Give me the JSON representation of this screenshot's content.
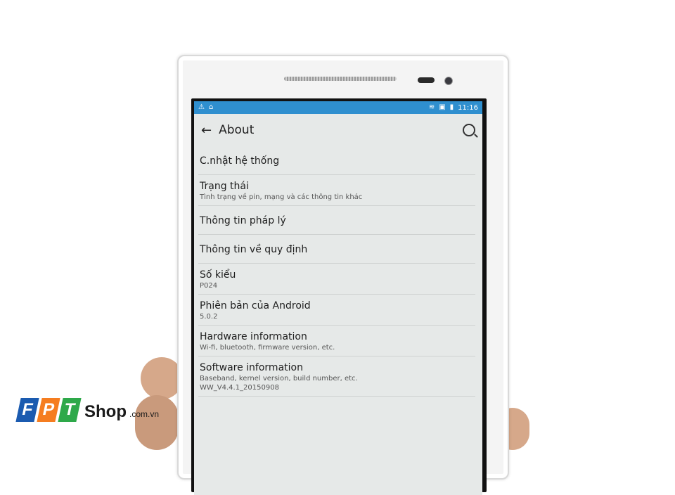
{
  "statusbar": {
    "time": "11:16",
    "left_icons": [
      "warning-icon",
      "home-icon"
    ],
    "right_icons": [
      "wifi-icon",
      "sim-icon",
      "battery-icon"
    ],
    "color": "#2f8fcf"
  },
  "appbar": {
    "title": "About",
    "back_icon": "arrow-left-icon",
    "search_icon": "search-icon"
  },
  "items": [
    {
      "title": "C.nhật hệ thống",
      "subtitle": ""
    },
    {
      "title": "Trạng thái",
      "subtitle": "Tình trạng về pin, mạng và các thông tin khác"
    },
    {
      "title": "Thông tin pháp lý",
      "subtitle": ""
    },
    {
      "title": "Thông tin về quy định",
      "subtitle": ""
    },
    {
      "title": "Số kiểu",
      "subtitle": "P024"
    },
    {
      "title": "Phiên bản của Android",
      "subtitle": "5.0.2"
    },
    {
      "title": "Hardware information",
      "subtitle": "Wi-fi, bluetooth, firmware version, etc."
    },
    {
      "title": "Software information",
      "subtitle": "Baseband, kernel version, build number, etc.",
      "subtitle2": "WW_V4.4.1_20150908"
    }
  ],
  "watermark": {
    "letters": [
      "F",
      "P",
      "T"
    ],
    "shop": "Shop",
    "domain": ".com.vn",
    "colors": [
      "#1b5bb0",
      "#f57d20",
      "#2ea94a"
    ]
  }
}
